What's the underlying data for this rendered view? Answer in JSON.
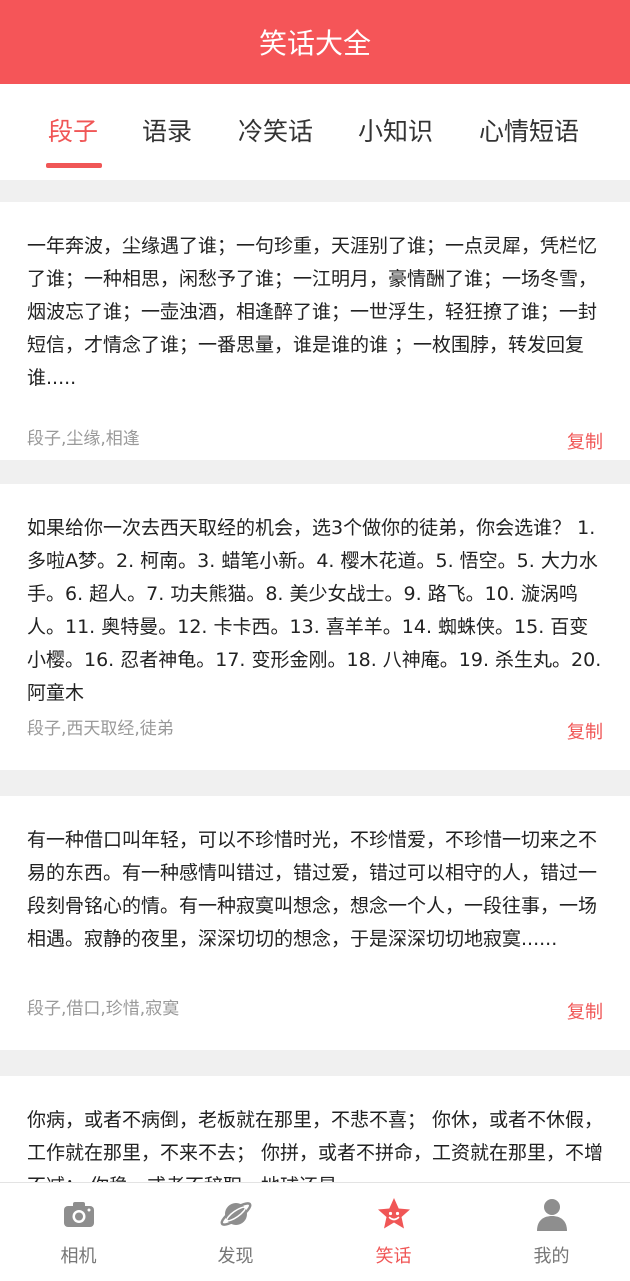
{
  "app": {
    "title": "笑话大全"
  },
  "tabs": [
    {
      "label": "段子"
    },
    {
      "label": "语录"
    },
    {
      "label": "冷笑话"
    },
    {
      "label": "小知识"
    },
    {
      "label": "心情短语"
    }
  ],
  "active_tab": "段子",
  "posts": [
    {
      "text": "一年奔波，尘缘遇了谁；一句珍重，天涯别了谁；一点灵犀，凭栏忆了谁；一种相思，闲愁予了谁；一江明月，豪情酬了谁；一场冬雪，烟波忘了谁；一壶浊酒，相逢醉了谁；一世浮生，轻狂撩了谁；一封短信，才情念了谁；一番思量，谁是谁的谁 ；一枚围脖，转发回复谁.....",
      "tags": "段子,尘缘,相逢",
      "copy_label": "复制"
    },
    {
      "text": "如果给你一次去西天取经的机会，选3个做你的徒弟，你会选谁？ 1. 多啦A梦。2. 柯南。3. 蜡笔小新。4. 樱木花道。5. 悟空。5. 大力水手。6. 超人。7. 功夫熊猫。8. 美少女战士。9. 路飞。10. 漩涡鸣人。11. 奥特曼。12. 卡卡西。13. 喜羊羊。14. 蜘蛛侠。15. 百变小樱。16. 忍者神龟。17. 变形金刚。18. 八神庵。19. 杀生丸。20. 阿童木",
      "tags": "段子,西天取经,徒弟",
      "copy_label": "复制"
    },
    {
      "text": "有一种借口叫年轻，可以不珍惜时光，不珍惜爱，不珍惜一切来之不易的东西。有一种感情叫错过，错过爱，错过可以相守的人，错过一段刻骨铭心的情。有一种寂寞叫想念，想念一个人，一段往事，一场相遇。寂静的夜里，深深切切的想念，于是深深切切地寂寞......",
      "tags": "段子,借口,珍惜,寂寞",
      "copy_label": "复制"
    },
    {
      "text": "你病，或者不病倒，老板就在那里，不悲不喜； 你休，或者不休假，工作就在那里，不来不去； 你拼，或者不拼命，工资就在那里，不增不减； 你稳，或者不辞职，地球还是",
      "tags": "",
      "copy_label": ""
    }
  ],
  "bottom_nav": [
    {
      "label": "相机",
      "icon": "camera-icon"
    },
    {
      "label": "发现",
      "icon": "planet-icon"
    },
    {
      "label": "笑话",
      "icon": "star-face-icon"
    },
    {
      "label": "我的",
      "icon": "person-icon"
    }
  ],
  "active_nav": "笑话",
  "colors": {
    "brand": "#f55558",
    "accent": "#f05656",
    "tag_text": "#999999",
    "background": "#f0f0f0"
  }
}
